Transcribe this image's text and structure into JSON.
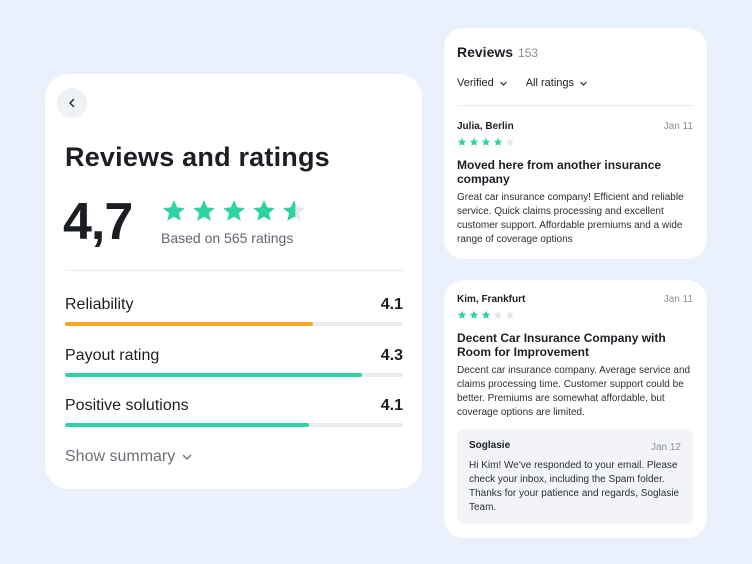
{
  "colors": {
    "accent": "#2ed3a4",
    "reliability_bar": "#f5a623",
    "track": "#e9ecef",
    "star_empty": "#e3e6ea"
  },
  "ratings": {
    "title": "Reviews and ratings",
    "score": "4,7",
    "score_value": 4.7,
    "based_on": "Based on 565 ratings",
    "metrics": [
      {
        "label": "Reliability",
        "value": "4.1",
        "fill": 0.733,
        "color": "#f5a623"
      },
      {
        "label": "Payout rating",
        "value": "4.3",
        "fill": 0.878,
        "color": "#2ed3a4"
      },
      {
        "label": "Positive solutions",
        "value": "4.1",
        "fill": 0.723,
        "color": "#2ed3a4"
      }
    ],
    "show_summary": "Show summary"
  },
  "reviews": {
    "title": "Reviews",
    "count": "153",
    "filters": {
      "verified": "Verified",
      "all_ratings": "All ratings"
    },
    "items": [
      {
        "author": "Julia, Berlin",
        "date": "Jan 11",
        "stars": 4,
        "headline": "Moved here from another insurance company",
        "body": "Great car insurance company! Efficient and reliable service. Quick claims processing and excellent customer support. Affordable premiums and a wide range of coverage options"
      },
      {
        "author": "Kim, Frankfurt",
        "date": "Jan 11",
        "stars": 3,
        "headline": "Decent Car Insurance Company with Room for Improvement",
        "body": "Decent car insurance company. Average service and claims processing time. Customer support could be better. Premiums are somewhat affordable, but coverage options are limited.",
        "reply": {
          "author": "Soglasie",
          "date": "Jan 12",
          "body": "Hi Kim! We've responded to your email. Please check your inbox, including the Spam folder. Thanks for your patience and regards, Soglasie Team."
        }
      }
    ]
  },
  "icons": {
    "back": "chevron-left-icon",
    "dropdown": "chevron-down-icon",
    "star": "star-icon"
  }
}
